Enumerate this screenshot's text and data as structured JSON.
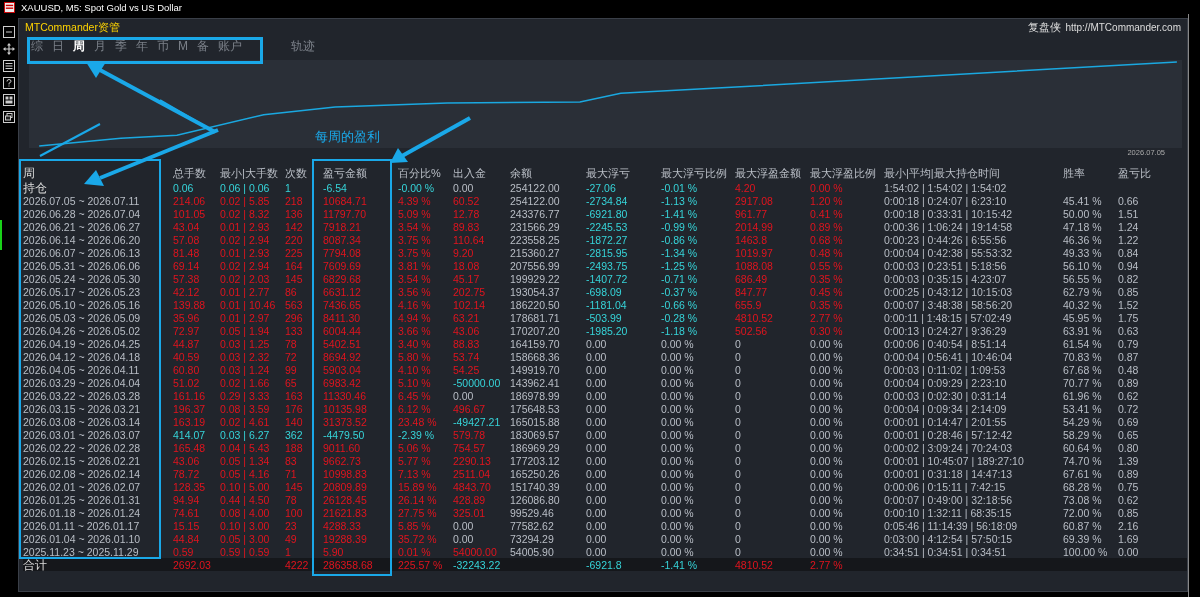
{
  "window": {
    "title": "XAUUSD, M5:  Spot Gold vs US Dollar"
  },
  "panel": {
    "title": "MTCommander资管",
    "brand": "复盘侠",
    "link": "http://MTCommander.com"
  },
  "tabs": [
    {
      "label": "综",
      "selected": false
    },
    {
      "label": "日",
      "selected": false
    },
    {
      "label": "周",
      "selected": true
    },
    {
      "label": "月",
      "selected": false
    },
    {
      "label": "季",
      "selected": false
    },
    {
      "label": "年",
      "selected": false
    },
    {
      "label": "币",
      "selected": false
    },
    {
      "label": "M",
      "selected": false
    },
    {
      "label": "备",
      "selected": false
    },
    {
      "label": "账户",
      "selected": false
    },
    {
      "label": "轨迹",
      "selected": false
    }
  ],
  "chart": {
    "end_label": "2026.07.05"
  },
  "callout": "每周的盈利",
  "table": {
    "columns": [
      "周",
      "总手数",
      "最小|大手数",
      "次数",
      "盈亏金额",
      "百分比%",
      "出入金",
      "余额",
      "最大浮亏",
      "最大浮亏比例",
      "最大浮盈金额",
      "最大浮盈比例",
      "最小|平均|最大持仓时间",
      "胜率",
      "盈亏比"
    ],
    "holding": {
      "cells": [
        "持仓",
        "0.06",
        "0.06 | 0.06",
        "1",
        "-6.54",
        "-0.00 %",
        "0.00",
        "254122.00",
        "-27.06",
        "-0.01 %",
        "4.20",
        "0.00 %",
        "1:54:02 | 1:54:02 | 1:54:02",
        null,
        null
      ],
      "loss": true,
      "flow_none": true,
      "float_active": true
    },
    "rows": [
      {
        "cells": [
          "2026.07.05 ~ 2026.07.11",
          "214.06",
          "0.02 | 5.85",
          "218",
          "10684.71",
          "4.39 %",
          "60.52",
          "254122.00",
          "-2734.84",
          "-1.13 %",
          "2917.08",
          "1.20 %",
          "0:00:18 | 0:24:07 | 6:23:10",
          "45.41 %",
          "0.66"
        ],
        "loss": false,
        "flow_out": false,
        "flow_none": false,
        "float_active": true
      },
      {
        "cells": [
          "2026.06.28 ~ 2026.07.04",
          "101.05",
          "0.02 | 8.32",
          "136",
          "11797.70",
          "5.09 %",
          "12.78",
          "243376.77",
          "-6921.80",
          "-1.41 %",
          "961.77",
          "0.41 %",
          "0:00:18 | 0:33:31 | 10:15:42",
          "50.00 %",
          "1.51"
        ],
        "loss": false,
        "flow_out": false,
        "flow_none": false,
        "float_active": true
      },
      {
        "cells": [
          "2026.06.21 ~ 2026.06.27",
          "43.04",
          "0.01 | 2.93",
          "142",
          "7918.21",
          "3.54 %",
          "89.83",
          "231566.29",
          "-2245.53",
          "-0.99 %",
          "2014.99",
          "0.89 %",
          "0:00:36 | 1:06:24 | 19:14:58",
          "47.18 %",
          "1.24"
        ],
        "loss": false,
        "flow_out": false,
        "flow_none": false,
        "float_active": true
      },
      {
        "cells": [
          "2026.06.14 ~ 2026.06.20",
          "57.08",
          "0.02 | 2.94",
          "220",
          "8087.34",
          "3.75 %",
          "110.64",
          "223558.25",
          "-1872.27",
          "-0.86 %",
          "1463.8",
          "0.68 %",
          "0:00:23 | 0:44:26 | 6:55:56",
          "46.36 %",
          "1.22"
        ],
        "loss": false,
        "flow_out": false,
        "flow_none": false,
        "float_active": true
      },
      {
        "cells": [
          "2026.06.07 ~ 2026.06.13",
          "81.48",
          "0.01 | 2.93",
          "225",
          "7794.08",
          "3.75 %",
          "9.20",
          "215360.27",
          "-2815.95",
          "-1.34 %",
          "1019.97",
          "0.48 %",
          "0:00:04 | 0:42:38 | 55:53:32",
          "49.33 %",
          "0.84"
        ],
        "loss": false,
        "flow_out": false,
        "flow_none": false,
        "float_active": true
      },
      {
        "cells": [
          "2026.05.31 ~ 2026.06.06",
          "69.14",
          "0.02 | 2.94",
          "164",
          "7609.69",
          "3.81 %",
          "18.08",
          "207556.99",
          "-2493.75",
          "-1.25 %",
          "1088.08",
          "0.55 %",
          "0:00:03 | 0:23:51 | 5:18:56",
          "56.10 %",
          "0.94"
        ],
        "loss": false,
        "flow_out": false,
        "flow_none": false,
        "float_active": true
      },
      {
        "cells": [
          "2026.05.24 ~ 2026.05.30",
          "57.38",
          "0.02 | 2.03",
          "145",
          "6829.68",
          "3.54 %",
          "45.17",
          "199929.22",
          "-1407.72",
          "-0.71 %",
          "686.49",
          "0.35 %",
          "0:00:03 | 0:35:15 | 4:23:07",
          "56.55 %",
          "0.82"
        ],
        "loss": false,
        "flow_out": false,
        "flow_none": false,
        "float_active": true
      },
      {
        "cells": [
          "2026.05.17 ~ 2026.05.23",
          "42.12",
          "0.01 | 2.77",
          "86",
          "6631.12",
          "3.56 %",
          "202.75",
          "193054.37",
          "-698.09",
          "-0.37 %",
          "847.77",
          "0.45 %",
          "0:00:25 | 0:43:12 | 10:15:03",
          "62.79 %",
          "0.85"
        ],
        "loss": false,
        "flow_out": false,
        "flow_none": false,
        "float_active": true
      },
      {
        "cells": [
          "2026.05.10 ~ 2026.05.16",
          "139.88",
          "0.01 | 10.46",
          "563",
          "7436.65",
          "4.16 %",
          "102.14",
          "186220.50",
          "-1181.04",
          "-0.66 %",
          "655.9",
          "0.35 %",
          "0:00:07 | 3:48:38 | 58:56:20",
          "40.32 %",
          "1.52"
        ],
        "loss": false,
        "flow_out": false,
        "flow_none": false,
        "float_active": true
      },
      {
        "cells": [
          "2026.05.03 ~ 2026.05.09",
          "35.96",
          "0.01 | 2.97",
          "296",
          "8411.30",
          "4.94 %",
          "63.21",
          "178681.71",
          "-503.99",
          "-0.28 %",
          "4810.52",
          "2.77 %",
          "0:00:11 | 1:48:15 | 57:02:49",
          "45.95 %",
          "1.75"
        ],
        "loss": false,
        "flow_out": false,
        "flow_none": false,
        "float_active": true
      },
      {
        "cells": [
          "2026.04.26 ~ 2026.05.02",
          "72.97",
          "0.05 | 1.94",
          "133",
          "6004.44",
          "3.66 %",
          "43.06",
          "170207.20",
          "-1985.20",
          "-1.18 %",
          "502.56",
          "0.30 %",
          "0:00:13 | 0:24:27 | 9:36:29",
          "63.91 %",
          "0.63"
        ],
        "loss": false,
        "flow_out": false,
        "flow_none": false,
        "float_active": true
      },
      {
        "cells": [
          "2026.04.19 ~ 2026.04.25",
          "44.87",
          "0.03 | 1.25",
          "78",
          "5402.51",
          "3.40 %",
          "88.83",
          "164159.70",
          "0.00",
          "0.00 %",
          "0",
          "0.00 %",
          "0:00:06 | 0:40:54 | 8:51:14",
          "61.54 %",
          "0.79"
        ],
        "loss": false,
        "flow_out": false,
        "flow_none": false,
        "float_active": false
      },
      {
        "cells": [
          "2026.04.12 ~ 2026.04.18",
          "40.59",
          "0.03 | 2.32",
          "72",
          "8694.92",
          "5.80 %",
          "53.74",
          "158668.36",
          "0.00",
          "0.00 %",
          "0",
          "0.00 %",
          "0:00:04 | 0:56:41 | 10:46:04",
          "70.83 %",
          "0.87"
        ],
        "loss": false,
        "flow_out": false,
        "flow_none": false,
        "float_active": false
      },
      {
        "cells": [
          "2026.04.05 ~ 2026.04.11",
          "60.80",
          "0.03 | 1.24",
          "99",
          "5903.04",
          "4.10 %",
          "54.25",
          "149919.70",
          "0.00",
          "0.00 %",
          "0",
          "0.00 %",
          "0:00:03 | 0:11:02 | 1:09:53",
          "67.68 %",
          "0.48"
        ],
        "loss": false,
        "flow_out": false,
        "flow_none": false,
        "float_active": false
      },
      {
        "cells": [
          "2026.03.29 ~ 2026.04.04",
          "51.02",
          "0.02 | 1.66",
          "65",
          "6983.42",
          "5.10 %",
          "-50000.00",
          "143962.41",
          "0.00",
          "0.00 %",
          "0",
          "0.00 %",
          "0:00:04 | 0:09:29 | 2:23:10",
          "70.77 %",
          "0.89"
        ],
        "loss": false,
        "flow_out": true,
        "flow_none": false,
        "float_active": false
      },
      {
        "cells": [
          "2026.03.22 ~ 2026.03.28",
          "161.16",
          "0.29 | 3.33",
          "163",
          "11330.46",
          "6.45 %",
          "0.00",
          "186978.99",
          "0.00",
          "0.00 %",
          "0",
          "0.00 %",
          "0:00:03 | 0:02:30 | 0:31:14",
          "61.96 %",
          "0.62"
        ],
        "loss": false,
        "flow_none": true,
        "float_active": false
      },
      {
        "cells": [
          "2026.03.15 ~ 2026.03.21",
          "196.37",
          "0.08 | 3.59",
          "176",
          "10135.98",
          "6.12 %",
          "496.67",
          "175648.53",
          "0.00",
          "0.00 %",
          "0",
          "0.00 %",
          "0:00:04 | 0:09:34 | 2:14:09",
          "53.41 %",
          "0.72"
        ],
        "loss": false,
        "flow_out": false,
        "flow_none": false,
        "float_active": false
      },
      {
        "cells": [
          "2026.03.08 ~ 2026.03.14",
          "163.19",
          "0.02 | 4.61",
          "140",
          "31373.52",
          "23.48 %",
          "-49427.21",
          "165015.88",
          "0.00",
          "0.00 %",
          "0",
          "0.00 %",
          "0:00:01 | 0:14:47 | 2:01:55",
          "54.29 %",
          "0.69"
        ],
        "loss": false,
        "flow_out": true,
        "flow_none": false,
        "float_active": false
      },
      {
        "cells": [
          "2026.03.01 ~ 2026.03.07",
          "414.07",
          "0.03 | 6.27",
          "362",
          "-4479.50",
          "-2.39 %",
          "579.78",
          "183069.57",
          "0.00",
          "0.00 %",
          "0",
          "0.00 %",
          "0:00:01 | 0:28:46 | 57:12:42",
          "58.29 %",
          "0.65"
        ],
        "loss": true,
        "flow_out": false,
        "flow_none": false,
        "float_active": false
      },
      {
        "cells": [
          "2026.02.22 ~ 2026.02.28",
          "165.48",
          "0.04 | 5.43",
          "188",
          "9011.60",
          "5.06 %",
          "754.57",
          "186969.29",
          "0.00",
          "0.00 %",
          "0",
          "0.00 %",
          "0:00:02 | 3:09:24 | 70:24:03",
          "60.64 %",
          "0.80"
        ],
        "loss": false,
        "flow_out": false,
        "flow_none": false,
        "float_active": false
      },
      {
        "cells": [
          "2026.02.15 ~ 2026.02.21",
          "43.06",
          "0.05 | 1.34",
          "83",
          "9662.73",
          "5.77 %",
          "2290.13",
          "177203.12",
          "0.00",
          "0.00 %",
          "0",
          "0.00 %",
          "0:00:01 | 10:45:07 | 189:27:10",
          "74.70 %",
          "1.39"
        ],
        "loss": false,
        "flow_out": false,
        "flow_none": false,
        "float_active": false
      },
      {
        "cells": [
          "2026.02.08 ~ 2026.02.14",
          "78.72",
          "0.05 | 4.16",
          "71",
          "10998.83",
          "7.13 %",
          "2511.04",
          "165250.26",
          "0.00",
          "0.00 %",
          "0",
          "0.00 %",
          "0:00:01 | 0:31:18 | 14:47:13",
          "67.61 %",
          "0.89"
        ],
        "loss": false,
        "flow_out": false,
        "flow_none": false,
        "float_active": false
      },
      {
        "cells": [
          "2026.02.01 ~ 2026.02.07",
          "128.35",
          "0.10 | 5.00",
          "145",
          "20809.89",
          "15.89 %",
          "4843.70",
          "151740.39",
          "0.00",
          "0.00 %",
          "0",
          "0.00 %",
          "0:00:06 | 0:15:11 | 7:42:15",
          "68.28 %",
          "0.75"
        ],
        "loss": false,
        "flow_out": false,
        "flow_none": false,
        "float_active": false
      },
      {
        "cells": [
          "2026.01.25 ~ 2026.01.31",
          "94.94",
          "0.44 | 4.50",
          "78",
          "26128.45",
          "26.14 %",
          "428.89",
          "126086.80",
          "0.00",
          "0.00 %",
          "0",
          "0.00 %",
          "0:00:07 | 0:49:00 | 32:18:56",
          "73.08 %",
          "0.62"
        ],
        "loss": false,
        "flow_out": false,
        "flow_none": false,
        "float_active": false
      },
      {
        "cells": [
          "2026.01.18 ~ 2026.01.24",
          "74.61",
          "0.08 | 4.00",
          "100",
          "21621.83",
          "27.75 %",
          "325.01",
          "99529.46",
          "0.00",
          "0.00 %",
          "0",
          "0.00 %",
          "0:00:10 | 1:32:11 | 68:35:15",
          "72.00 %",
          "0.85"
        ],
        "loss": false,
        "flow_out": false,
        "flow_none": false,
        "float_active": false
      },
      {
        "cells": [
          "2026.01.11 ~ 2026.01.17",
          "15.15",
          "0.10 | 3.00",
          "23",
          "4288.33",
          "5.85 %",
          "0.00",
          "77582.62",
          "0.00",
          "0.00 %",
          "0",
          "0.00 %",
          "0:05:46 | 11:14:39 | 56:18:09",
          "60.87 %",
          "2.16"
        ],
        "loss": false,
        "flow_none": true,
        "float_active": false
      },
      {
        "cells": [
          "2026.01.04 ~ 2026.01.10",
          "44.84",
          "0.05 | 3.00",
          "49",
          "19288.39",
          "35.72 %",
          "0.00",
          "73294.29",
          "0.00",
          "0.00 %",
          "0",
          "0.00 %",
          "0:03:00 | 4:12:54 | 57:50:15",
          "69.39 %",
          "1.69"
        ],
        "loss": false,
        "flow_none": true,
        "float_active": false
      },
      {
        "cells": [
          "2025.11.23 ~ 2025.11.29",
          "0.59",
          "0.59 | 0.59",
          "1",
          "5.90",
          "0.01 %",
          "54000.00",
          "54005.90",
          "0.00",
          "0.00 %",
          "0",
          "0.00 %",
          "0:34:51 | 0:34:51 | 0:34:51",
          "100.00 %",
          "0.00"
        ],
        "loss": false,
        "flow_out": false,
        "flow_none": false,
        "float_active": false
      }
    ],
    "total": {
      "cells": [
        "合计",
        "2692.03",
        null,
        "4222",
        "286358.68",
        "225.57 %",
        "-32243.22",
        null,
        "-6921.8",
        "-1.41 %",
        "4810.52",
        "2.77 %",
        null,
        null,
        null
      ],
      "loss": false,
      "flow_out": true,
      "flow_none": false,
      "float_active": true
    }
  }
}
